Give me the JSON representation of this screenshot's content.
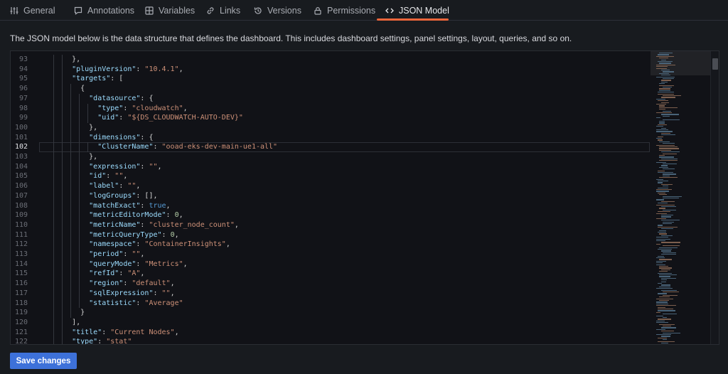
{
  "tabs": [
    {
      "label": "General",
      "icon": "sliders-icon"
    },
    {
      "label": "Annotations",
      "icon": "comment-icon"
    },
    {
      "label": "Variables",
      "icon": "grid-icon"
    },
    {
      "label": "Links",
      "icon": "link-icon"
    },
    {
      "label": "Versions",
      "icon": "history-icon"
    },
    {
      "label": "Permissions",
      "icon": "lock-icon"
    },
    {
      "label": "JSON Model",
      "icon": "code-brackets-icon",
      "active": true
    }
  ],
  "description": "The JSON model below is the data structure that defines the dashboard. This includes dashboard settings, panel settings, layout, queries, and so on.",
  "editor": {
    "current_line": "102",
    "lines": [
      {
        "n": "93",
        "t": [
          [
            "p",
            "},"
          ]
        ]
      },
      {
        "n": "94",
        "t": [
          [
            "k",
            "\"pluginVersion\""
          ],
          [
            "p",
            ": "
          ],
          [
            "s",
            "\"10.4.1\""
          ],
          [
            "p",
            ","
          ]
        ]
      },
      {
        "n": "95",
        "t": [
          [
            "k",
            "\"targets\""
          ],
          [
            "p",
            ": ["
          ]
        ]
      },
      {
        "n": "96",
        "t": [
          [
            "p",
            "{"
          ]
        ]
      },
      {
        "n": "97",
        "t": [
          [
            "k",
            "\"datasource\""
          ],
          [
            "p",
            ": {"
          ]
        ]
      },
      {
        "n": "98",
        "t": [
          [
            "k",
            "\"type\""
          ],
          [
            "p",
            ": "
          ],
          [
            "s",
            "\"cloudwatch\""
          ],
          [
            "p",
            ","
          ]
        ]
      },
      {
        "n": "99",
        "t": [
          [
            "k",
            "\"uid\""
          ],
          [
            "p",
            ": "
          ],
          [
            "s",
            "\"${DS_CLOUDWATCH-AUTO-DEV}\""
          ]
        ]
      },
      {
        "n": "100",
        "t": [
          [
            "p",
            "},"
          ]
        ]
      },
      {
        "n": "101",
        "t": [
          [
            "k",
            "\"dimensions\""
          ],
          [
            "p",
            ": {"
          ]
        ]
      },
      {
        "n": "102",
        "t": [
          [
            "k",
            "\"ClusterName\""
          ],
          [
            "p",
            ": "
          ],
          [
            "s",
            "\"ooad-eks-dev-main-ue1-all\""
          ]
        ]
      },
      {
        "n": "103",
        "t": [
          [
            "p",
            "},"
          ]
        ]
      },
      {
        "n": "104",
        "t": [
          [
            "k",
            "\"expression\""
          ],
          [
            "p",
            ": "
          ],
          [
            "s",
            "\"\""
          ],
          [
            "p",
            ","
          ]
        ]
      },
      {
        "n": "105",
        "t": [
          [
            "k",
            "\"id\""
          ],
          [
            "p",
            ": "
          ],
          [
            "s",
            "\"\""
          ],
          [
            "p",
            ","
          ]
        ]
      },
      {
        "n": "106",
        "t": [
          [
            "k",
            "\"label\""
          ],
          [
            "p",
            ": "
          ],
          [
            "s",
            "\"\""
          ],
          [
            "p",
            ","
          ]
        ]
      },
      {
        "n": "107",
        "t": [
          [
            "k",
            "\"logGroups\""
          ],
          [
            "p",
            ": [],"
          ]
        ]
      },
      {
        "n": "108",
        "t": [
          [
            "k",
            "\"matchExact\""
          ],
          [
            "p",
            ": "
          ],
          [
            "b",
            "true"
          ],
          [
            "p",
            ","
          ]
        ]
      },
      {
        "n": "109",
        "t": [
          [
            "k",
            "\"metricEditorMode\""
          ],
          [
            "p",
            ": "
          ],
          [
            "n",
            "0"
          ],
          [
            "p",
            ","
          ]
        ]
      },
      {
        "n": "110",
        "t": [
          [
            "k",
            "\"metricName\""
          ],
          [
            "p",
            ": "
          ],
          [
            "s",
            "\"cluster_node_count\""
          ],
          [
            "p",
            ","
          ]
        ]
      },
      {
        "n": "111",
        "t": [
          [
            "k",
            "\"metricQueryType\""
          ],
          [
            "p",
            ": "
          ],
          [
            "n",
            "0"
          ],
          [
            "p",
            ","
          ]
        ]
      },
      {
        "n": "112",
        "t": [
          [
            "k",
            "\"namespace\""
          ],
          [
            "p",
            ": "
          ],
          [
            "s",
            "\"ContainerInsights\""
          ],
          [
            "p",
            ","
          ]
        ]
      },
      {
        "n": "113",
        "t": [
          [
            "k",
            "\"period\""
          ],
          [
            "p",
            ": "
          ],
          [
            "s",
            "\"\""
          ],
          [
            "p",
            ","
          ]
        ]
      },
      {
        "n": "114",
        "t": [
          [
            "k",
            "\"queryMode\""
          ],
          [
            "p",
            ": "
          ],
          [
            "s",
            "\"Metrics\""
          ],
          [
            "p",
            ","
          ]
        ]
      },
      {
        "n": "115",
        "t": [
          [
            "k",
            "\"refId\""
          ],
          [
            "p",
            ": "
          ],
          [
            "s",
            "\"A\""
          ],
          [
            "p",
            ","
          ]
        ]
      },
      {
        "n": "116",
        "t": [
          [
            "k",
            "\"region\""
          ],
          [
            "p",
            ": "
          ],
          [
            "s",
            "\"default\""
          ],
          [
            "p",
            ","
          ]
        ]
      },
      {
        "n": "117",
        "t": [
          [
            "k",
            "\"sqlExpression\""
          ],
          [
            "p",
            ": "
          ],
          [
            "s",
            "\"\""
          ],
          [
            "p",
            ","
          ]
        ]
      },
      {
        "n": "118",
        "t": [
          [
            "k",
            "\"statistic\""
          ],
          [
            "p",
            ": "
          ],
          [
            "s",
            "\"Average\""
          ]
        ]
      },
      {
        "n": "119",
        "t": [
          [
            "p",
            "}"
          ]
        ]
      },
      {
        "n": "120",
        "t": [
          [
            "p",
            "],"
          ]
        ]
      },
      {
        "n": "121",
        "t": [
          [
            "k",
            "\"title\""
          ],
          [
            "p",
            ": "
          ],
          [
            "s",
            "\"Current Nodes\""
          ],
          [
            "p",
            ","
          ]
        ]
      },
      {
        "n": "122",
        "t": [
          [
            "k",
            "\"type\""
          ],
          [
            "p",
            ": "
          ],
          [
            "s",
            "\"stat\""
          ]
        ]
      }
    ]
  },
  "save_button": "Save changes",
  "colors": {
    "accent": "#f0663b",
    "primary_button": "#3d71d9",
    "json_key": "#9cdcfe",
    "json_string": "#ce9178",
    "json_number": "#b5cea8",
    "json_boolean": "#569cd6"
  }
}
